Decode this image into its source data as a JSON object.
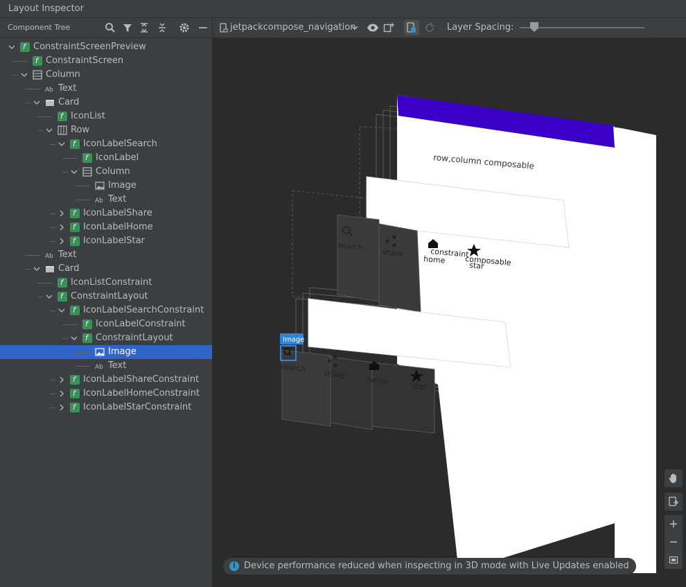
{
  "window": {
    "title": "Layout Inspector"
  },
  "component_tree": {
    "title": "Component Tree",
    "toolbar_icons": [
      "search-icon",
      "filter-icon",
      "expand-all-icon",
      "collapse-all-icon",
      "gear-icon",
      "minimize-icon"
    ],
    "rows": [
      {
        "label": "ConstraintScreenPreview",
        "type": "composable",
        "depth": 0,
        "expander": "open"
      },
      {
        "label": "ConstraintScreen",
        "type": "composable",
        "depth": 1,
        "expander": "none"
      },
      {
        "label": "Column",
        "type": "column",
        "depth": 1,
        "expander": "open"
      },
      {
        "label": "Text",
        "type": "text",
        "depth": 2,
        "expander": "none"
      },
      {
        "label": "Card",
        "type": "card",
        "depth": 2,
        "expander": "open"
      },
      {
        "label": "IconList",
        "type": "composable",
        "depth": 3,
        "expander": "none"
      },
      {
        "label": "Row",
        "type": "row",
        "depth": 3,
        "expander": "open"
      },
      {
        "label": "IconLabelSearch",
        "type": "composable",
        "depth": 4,
        "expander": "open"
      },
      {
        "label": "IconLabel",
        "type": "composable",
        "depth": 5,
        "expander": "none"
      },
      {
        "label": "Column",
        "type": "column",
        "depth": 5,
        "expander": "open"
      },
      {
        "label": "Image",
        "type": "image",
        "depth": 6,
        "expander": "none"
      },
      {
        "label": "Text",
        "type": "text",
        "depth": 6,
        "expander": "none"
      },
      {
        "label": "IconLabelShare",
        "type": "composable",
        "depth": 4,
        "expander": "closed"
      },
      {
        "label": "IconLabelHome",
        "type": "composable",
        "depth": 4,
        "expander": "closed"
      },
      {
        "label": "IconLabelStar",
        "type": "composable",
        "depth": 4,
        "expander": "closed"
      },
      {
        "label": "Text",
        "type": "text",
        "depth": 2,
        "expander": "none"
      },
      {
        "label": "Card",
        "type": "card",
        "depth": 2,
        "expander": "open"
      },
      {
        "label": "IconListConstraint",
        "type": "composable",
        "depth": 3,
        "expander": "none"
      },
      {
        "label": "ConstraintLayout",
        "type": "composable",
        "depth": 3,
        "expander": "open"
      },
      {
        "label": "IconLabelSearchConstraint",
        "type": "composable",
        "depth": 4,
        "expander": "open"
      },
      {
        "label": "IconLabelConstraint",
        "type": "composable",
        "depth": 5,
        "expander": "none"
      },
      {
        "label": "ConstraintLayout",
        "type": "composable",
        "depth": 5,
        "expander": "open"
      },
      {
        "label": "Image",
        "type": "image",
        "depth": 6,
        "expander": "none",
        "selected": true
      },
      {
        "label": "Text",
        "type": "text",
        "depth": 6,
        "expander": "none"
      },
      {
        "label": "IconLabelShareConstraint",
        "type": "composable",
        "depth": 4,
        "expander": "closed"
      },
      {
        "label": "IconLabelHomeConstraint",
        "type": "composable",
        "depth": 4,
        "expander": "closed"
      },
      {
        "label": "IconLabelStarConstraint",
        "type": "composable",
        "depth": 4,
        "expander": "closed"
      }
    ]
  },
  "inspector": {
    "process": "jetpackcompose_navigation",
    "layer_spacing_label": "Layer Spacing:",
    "toolbar_icons": [
      "device-icon",
      "chevron-down-icon",
      "eye-icon",
      "snapshot-icon",
      "live-updates-icon",
      "refresh-icon"
    ],
    "preview": {
      "top_text": "row,column composable",
      "labels_row1": [
        "search",
        "share",
        "home",
        "star"
      ],
      "overlap_labels": [
        "constraint",
        "composable"
      ],
      "labels_row2": [
        "search",
        "share",
        "home",
        "star"
      ],
      "selected_tag": "Image",
      "accent": "#3a00c8"
    },
    "side_buttons": [
      "pan-hand-icon",
      "reset-view-icon",
      "zoom-in-icon",
      "zoom-out-icon",
      "fit-screen-icon"
    ],
    "notification": "Device performance reduced when inspecting in 3D mode with Live Updates enabled"
  }
}
